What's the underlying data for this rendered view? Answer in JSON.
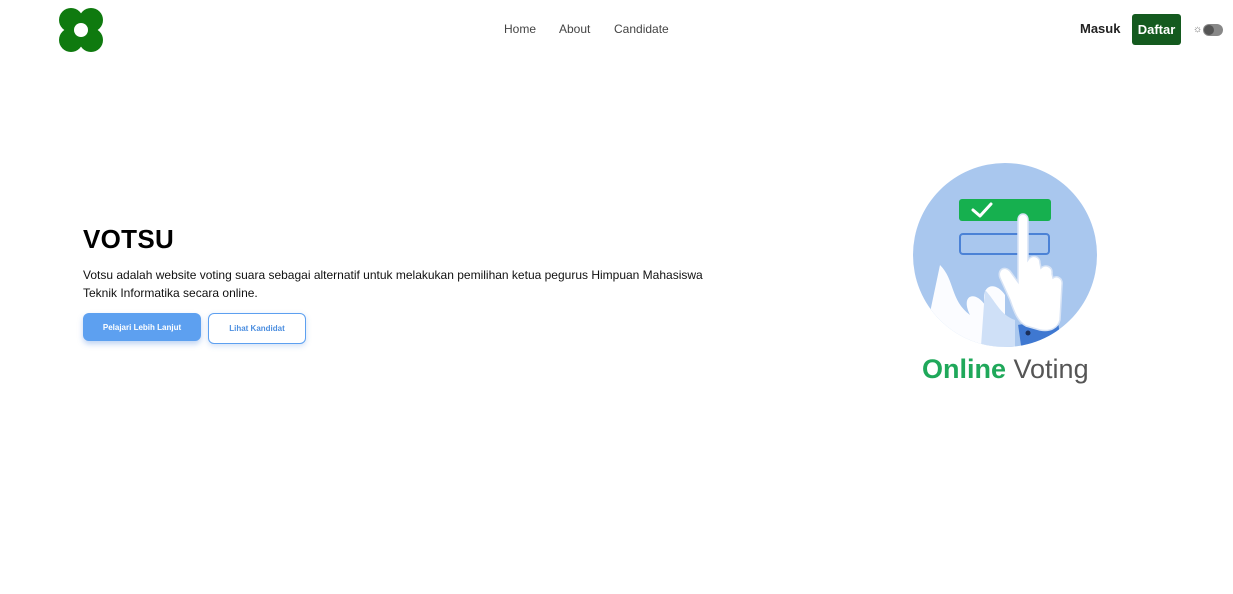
{
  "nav": {
    "logo": "clover-logo",
    "links": [
      "Home",
      "About",
      "Candidate"
    ],
    "login_label": "Masuk",
    "register_label": "Daftar",
    "theme_toggle_icon": "sun-icon"
  },
  "hero": {
    "title": "VOTSU",
    "description": "Votsu adalah website voting suara sebagai alternatif untuk melakukan pemilihan ketua pegurus Himpuan Mahasiswa Teknik Informatika secara online.",
    "primary_button": "Pelajari Lebih Lanjut",
    "secondary_button": "Lihat Kandidat"
  },
  "illustration": {
    "brand_word_1": "Online",
    "brand_word_2": " Voting",
    "icon": "hand-checkbox-icon"
  },
  "colors": {
    "brand_green": "#145a1f",
    "logo_green": "#0f7a0f",
    "primary_blue": "#5da0f0",
    "online_green": "#1fa85a"
  }
}
